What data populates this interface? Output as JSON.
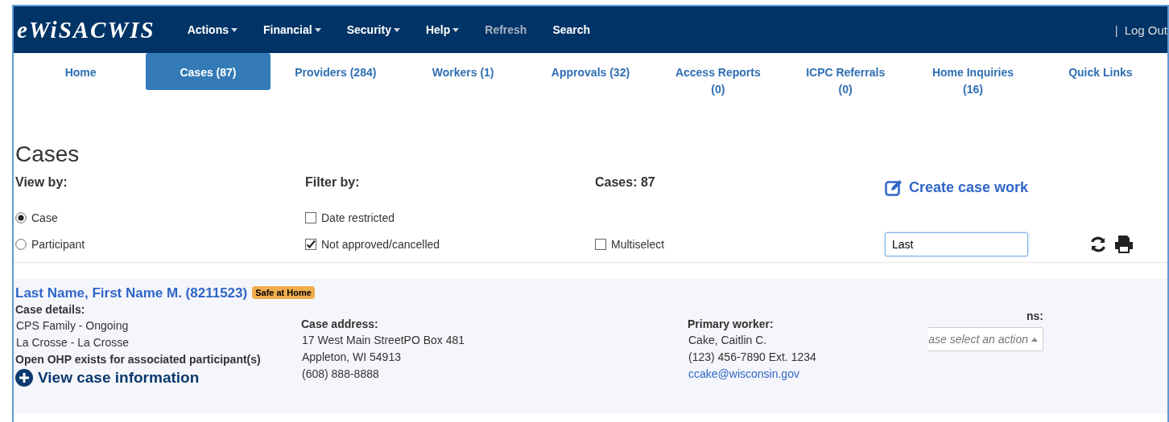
{
  "header": {
    "logo": "eWiSACWIS",
    "menu": [
      {
        "label": "Actions",
        "dropdown": true,
        "disabled": false
      },
      {
        "label": "Financial",
        "dropdown": true,
        "disabled": false
      },
      {
        "label": "Security",
        "dropdown": true,
        "disabled": false
      },
      {
        "label": "Help",
        "dropdown": true,
        "disabled": false
      },
      {
        "label": "Refresh",
        "dropdown": false,
        "disabled": true
      },
      {
        "label": "Search",
        "dropdown": false,
        "disabled": false
      }
    ],
    "separator": "|",
    "logout": "Log Out"
  },
  "tabs": [
    {
      "label": "Home",
      "selected": false
    },
    {
      "label": "Cases (87)",
      "selected": true
    },
    {
      "label": "Providers (284)",
      "selected": false
    },
    {
      "label": "Workers (1)",
      "selected": false
    },
    {
      "label": "Approvals (32)",
      "selected": false
    },
    {
      "label": "Access Reports (0)",
      "selected": false
    },
    {
      "label": "ICPC Referrals (0)",
      "selected": false
    },
    {
      "label": "Home Inquiries (16)",
      "selected": false
    },
    {
      "label": "Quick Links",
      "selected": false
    }
  ],
  "page_title": "Cases",
  "view_by": {
    "label": "View by:",
    "options": [
      {
        "label": "Case",
        "selected": true
      },
      {
        "label": "Participant",
        "selected": false
      }
    ]
  },
  "filter_by": {
    "label": "Filter by:",
    "options": [
      {
        "label": "Date restricted",
        "checked": false
      },
      {
        "label": "Not approved/cancelled",
        "checked": true
      }
    ]
  },
  "cases_count": "Cases: 87",
  "multiselect": {
    "label": "Multiselect",
    "checked": false
  },
  "create_case_work": "Create case work",
  "search": {
    "value": "Last"
  },
  "case": {
    "name": "Last Name, First Name M. (8211523)",
    "badge": "Safe at Home",
    "details_label": "Case details:",
    "details": [
      "CPS Family - Ongoing",
      "La Crosse - La Crosse"
    ],
    "notice": "Open OHP exists for associated participant(s)",
    "view_link": "View case information",
    "address_label": "Case address:",
    "address": [
      "17 West Main StreetPO Box 481",
      "Appleton, WI 54913",
      "(608) 888-8888"
    ],
    "worker_label": "Primary worker:",
    "worker": [
      "Cake, Caitlin C.",
      "(123) 456-7890 Ext. 1234"
    ],
    "worker_email": "ccake@wisconsin.gov",
    "actions_label": "ns:",
    "actions_placeholder": "ase select an action"
  }
}
